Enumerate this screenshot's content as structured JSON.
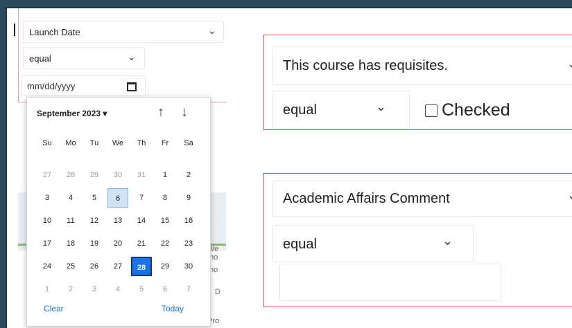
{
  "left_filter": {
    "field": "Launch Date",
    "operator": "equal",
    "date_placeholder": "mm/dd/yyyy"
  },
  "calendar": {
    "month_label": "September 2023 ▾",
    "weekdays": [
      "Su",
      "Mo",
      "Tu",
      "We",
      "Th",
      "Fr",
      "Sa"
    ],
    "weeks": [
      [
        "27",
        "28",
        "29",
        "30",
        "31",
        "1",
        "2"
      ],
      [
        "3",
        "4",
        "5",
        "6",
        "7",
        "8",
        "9"
      ],
      [
        "10",
        "11",
        "12",
        "13",
        "14",
        "15",
        "16"
      ],
      [
        "17",
        "18",
        "19",
        "20",
        "21",
        "22",
        "23"
      ],
      [
        "24",
        "25",
        "26",
        "27",
        "28",
        "29",
        "30"
      ],
      [
        "1",
        "2",
        "3",
        "4",
        "5",
        "6",
        "7"
      ]
    ],
    "today_day": "6",
    "selected_day": "28",
    "clear_label": "Clear",
    "today_label": "Today"
  },
  "background_peek": {
    "we": "We",
    "mo": "mo",
    "mo2": "mo",
    "d": "D",
    "pro": "Pro"
  },
  "requisites_filter": {
    "field": "This course has requisites.",
    "operator": "equal",
    "checkbox_label": "Checked",
    "checked": false
  },
  "comment_filter": {
    "field": "Academic Affairs Comment",
    "operator": "equal",
    "value": ""
  },
  "colors": {
    "panel_border": "#d94a5c",
    "selected_day": "#1a73e8",
    "today_day": "#cfe3f6"
  }
}
